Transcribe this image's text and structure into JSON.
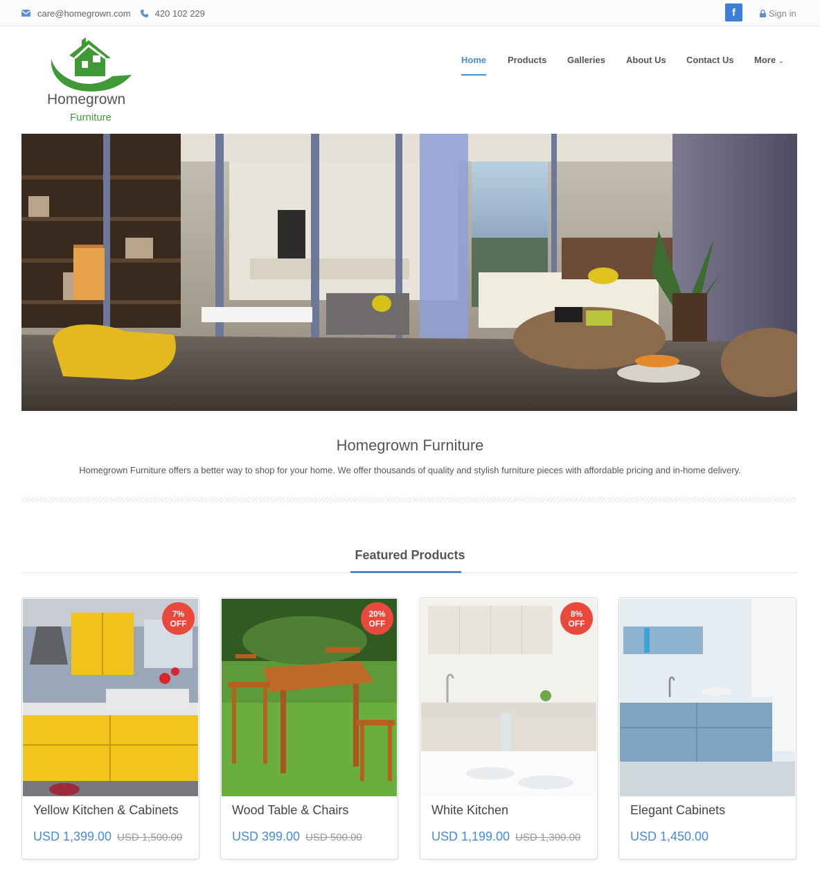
{
  "topbar": {
    "email": "care@homegrown.com",
    "phone": "420 102 229",
    "facebook_icon_label": "f",
    "signin_label": "Sign in"
  },
  "brand": {
    "name_line1": "Homegrown",
    "name_line2": "Furniture",
    "green": "#3f9a35"
  },
  "nav": {
    "items": [
      {
        "label": "Home"
      },
      {
        "label": "Products"
      },
      {
        "label": "Galleries"
      },
      {
        "label": "About Us"
      },
      {
        "label": "Contact Us"
      },
      {
        "label": "More"
      }
    ],
    "active_color": "#4a8ad4"
  },
  "intro": {
    "title": "Homegrown Furniture",
    "text": "Homegrown Furniture offers a better way to shop for your home. We offer thousands of quality and stylish furniture pieces with affordable pricing and in-home delivery."
  },
  "featured": {
    "title": "Featured Products",
    "products": [
      {
        "name": "Yellow Kitchen & Cabinets",
        "price": "USD 1,399.00",
        "old_price": "USD 1,500.00",
        "badge_pct": "7%",
        "badge_off": "OFF"
      },
      {
        "name": "Wood Table & Chairs",
        "price": "USD 399.00",
        "old_price": "USD 500.00",
        "badge_pct": "20%",
        "badge_off": "OFF"
      },
      {
        "name": "White Kitchen",
        "price": "USD 1,199.00",
        "old_price": "USD 1,300.00",
        "badge_pct": "8%",
        "badge_off": "OFF"
      },
      {
        "name": "Elegant Cabinets",
        "price": "USD 1,450.00"
      }
    ]
  },
  "colors": {
    "accent": "#4a8ad4",
    "badge": "#e8493c",
    "facebook": "#3b7fd9"
  }
}
